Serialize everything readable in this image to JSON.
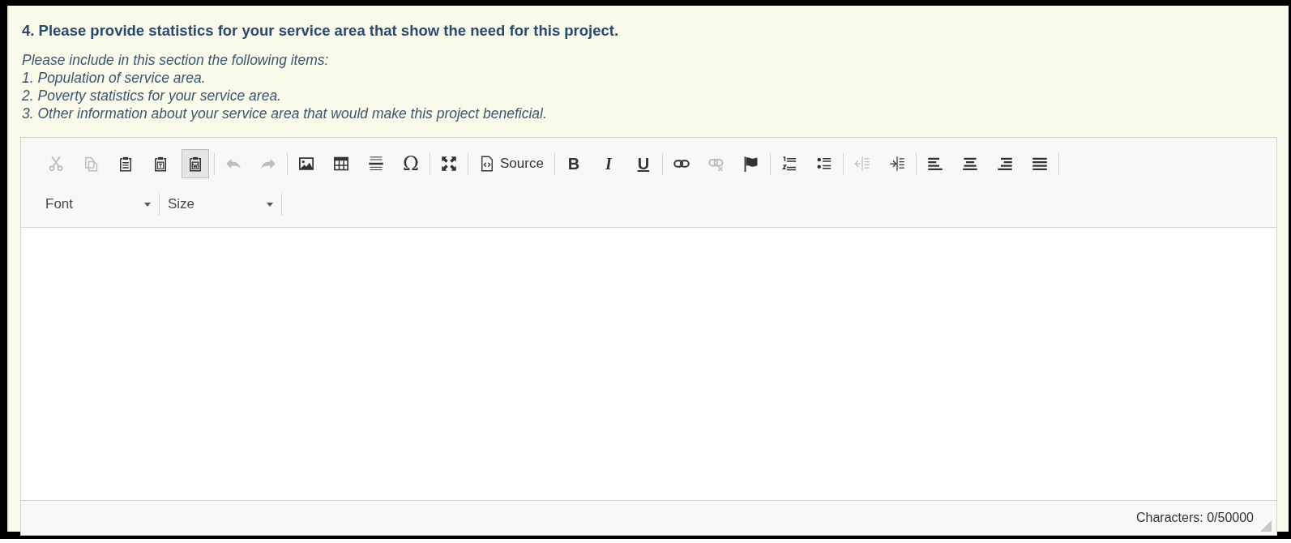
{
  "question": {
    "title": "4. Please provide statistics for your service area that show the need for this project.",
    "instructions": [
      "Please include in this section the following items:",
      "1. Population of service area.",
      "2. Poverty statistics for your service area.",
      "3. Other information about your service area that would make this project beneficial."
    ]
  },
  "editor": {
    "toolbar_groups": [
      [
        {
          "kind": "cut",
          "disabled": true,
          "on": false
        },
        {
          "kind": "copy",
          "disabled": true,
          "on": false
        },
        {
          "kind": "paste",
          "disabled": false,
          "on": false
        },
        {
          "kind": "paste-text",
          "disabled": false,
          "on": false
        },
        {
          "kind": "paste-word",
          "disabled": false,
          "on": true
        }
      ],
      [
        {
          "kind": "undo",
          "disabled": true,
          "on": false
        },
        {
          "kind": "redo",
          "disabled": true,
          "on": false
        }
      ],
      [
        {
          "kind": "image",
          "disabled": false,
          "on": false
        },
        {
          "kind": "table",
          "disabled": false,
          "on": false
        },
        {
          "kind": "rule",
          "disabled": false,
          "on": false
        },
        {
          "kind": "char",
          "label": "Ω",
          "disabled": false,
          "on": false
        }
      ],
      [
        {
          "kind": "maximize",
          "disabled": false,
          "on": false
        }
      ],
      [
        {
          "kind": "source",
          "label": "Source",
          "disabled": false,
          "on": false
        }
      ],
      [
        {
          "kind": "bold",
          "label": "B",
          "disabled": false,
          "on": false
        },
        {
          "kind": "italic",
          "label": "I",
          "disabled": false,
          "on": false
        },
        {
          "kind": "underline",
          "label": "U",
          "disabled": false,
          "on": false
        }
      ],
      [
        {
          "kind": "link",
          "disabled": false,
          "on": false
        },
        {
          "kind": "unlink",
          "disabled": true,
          "on": false
        },
        {
          "kind": "anchor",
          "disabled": false,
          "on": false
        }
      ],
      [
        {
          "kind": "numbered-list",
          "disabled": false,
          "on": false
        },
        {
          "kind": "bulleted-list",
          "disabled": false,
          "on": false
        }
      ],
      [
        {
          "kind": "outdent",
          "disabled": true,
          "on": false
        },
        {
          "kind": "indent",
          "disabled": false,
          "on": false
        }
      ],
      [
        {
          "kind": "align-left",
          "disabled": false,
          "on": false
        },
        {
          "kind": "align-center",
          "disabled": false,
          "on": false
        },
        {
          "kind": "align-right",
          "disabled": false,
          "on": false
        },
        {
          "kind": "justify",
          "disabled": false,
          "on": false
        }
      ]
    ],
    "combos": [
      {
        "label": "Font"
      },
      {
        "label": "Size"
      }
    ],
    "character_count": "Characters: 0/50000"
  }
}
